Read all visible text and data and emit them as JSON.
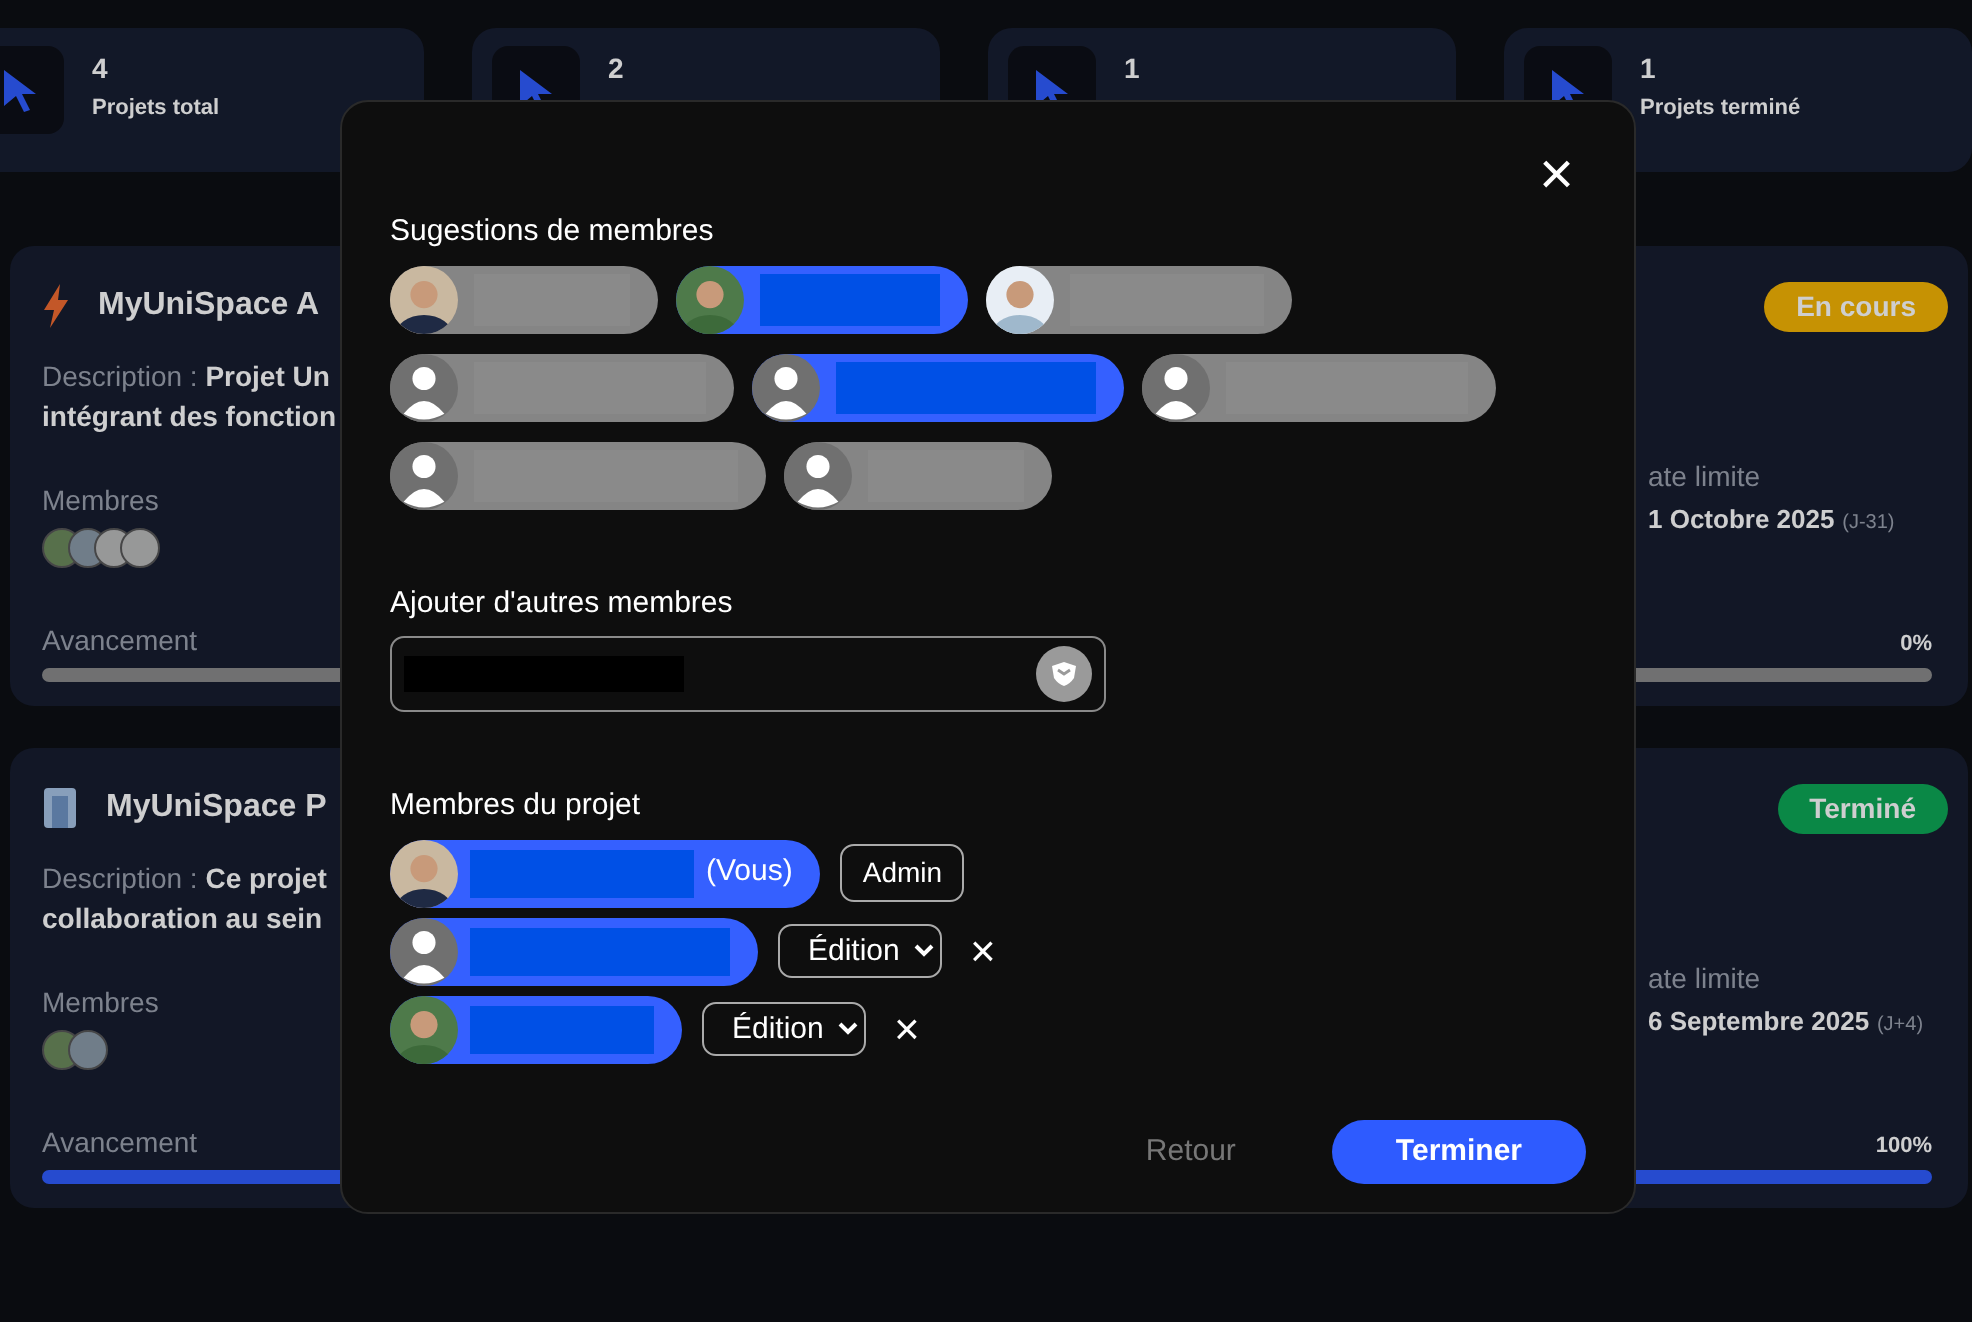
{
  "stats": [
    {
      "value": "4",
      "label": "Projets total"
    },
    {
      "value": "2"
    },
    {
      "value": "1"
    },
    {
      "value": "1",
      "label": "Projets terminé"
    }
  ],
  "projects": [
    {
      "title": "MyUniSpace A",
      "description_label": "Description :",
      "description": "Projet Un",
      "description_line_2": "intégrant des fonction",
      "members_label": "Membres",
      "status": "En cours",
      "kind": "in_progress",
      "deadline_label": "ate limite",
      "deadline": "1 Octobre 2025",
      "deadline_note": "(J-31)",
      "progress_label": "Avancement",
      "percent": "0%",
      "level": 0
    },
    {
      "title": "MyUniSpace P",
      "description_label": "Description :",
      "description": "Ce projet",
      "description_line_2": "collaboration au sein",
      "members_label": "Membres",
      "status": "Terminé",
      "kind": "done",
      "deadline_label": "ate limite",
      "deadline": "6 Septembre 2025",
      "deadline_note": "(J+4)",
      "progress_label": "Avancement",
      "percent": "100%",
      "level": 1
    }
  ],
  "modal": {
    "close": "×",
    "suggestions_title": "Sugestions de membres",
    "suggestions": [
      {
        "kind": "photo",
        "selected": false
      },
      {
        "kind": "photo",
        "selected": true
      },
      {
        "kind": "photo",
        "selected": false
      },
      {
        "kind": "default",
        "selected": false
      },
      {
        "kind": "default",
        "selected": true
      },
      {
        "kind": "default",
        "selected": false
      },
      {
        "kind": "default",
        "selected": false
      },
      {
        "kind": "default",
        "selected": false
      }
    ],
    "add_title": "Ajouter d'autres membres",
    "members_title": "Membres du projet",
    "members": [
      {
        "suffix": "(Vous)",
        "role": "Admin",
        "kind": "fixed"
      },
      {
        "role": "Édition",
        "kind": "editable",
        "remove": "×"
      },
      {
        "role": "Édition",
        "kind": "editable",
        "remove": "×"
      }
    ],
    "back": "Retour",
    "finish": "Terminer"
  }
}
